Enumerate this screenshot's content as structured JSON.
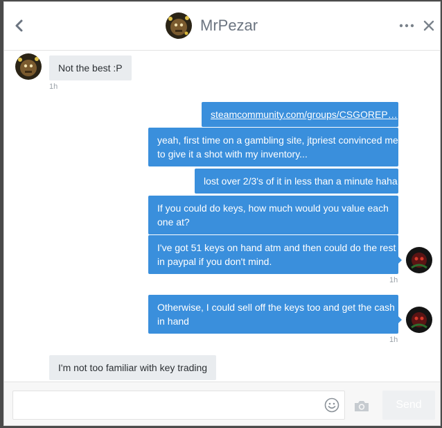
{
  "header": {
    "contact_name": "MrPezar",
    "icons": [
      "chevron-left-icon",
      "more-icon",
      "close-icon"
    ]
  },
  "messages": [
    {
      "direction": "in",
      "text": "Not the best :P",
      "time": "1h"
    },
    {
      "direction": "out",
      "text": "steamcommunity.com/groups/CSGOREP…",
      "is_link": true
    },
    {
      "direction": "out",
      "lines": [
        "yeah, first time on a gambling site, jtpriest convinced me",
        "to give it a shot with my inventory..."
      ]
    },
    {
      "direction": "out",
      "text": "lost over 2/3's of it in less than a minute haha"
    },
    {
      "direction": "out",
      "lines": [
        "If you could do keys, how much would you value each",
        "one at?"
      ]
    },
    {
      "direction": "out",
      "lines": [
        "I've got 51 keys on hand atm and then could do the rest",
        "in paypal if you don't mind."
      ],
      "time": "1h"
    },
    {
      "direction": "out",
      "lines": [
        "Otherwise, I could sell off the keys too and get the cash",
        "in hand"
      ],
      "time": "1h"
    },
    {
      "direction": "in",
      "text": "I'm not too familiar with key trading"
    }
  ],
  "composer": {
    "placeholder": "",
    "send_label": "Send",
    "icons": [
      "emoji-icon",
      "camera-icon"
    ]
  },
  "colors": {
    "outgoing_bubble": "#3a8fdc",
    "incoming_bubble": "#e9ecef",
    "send_disabled": "#eef0f2"
  }
}
